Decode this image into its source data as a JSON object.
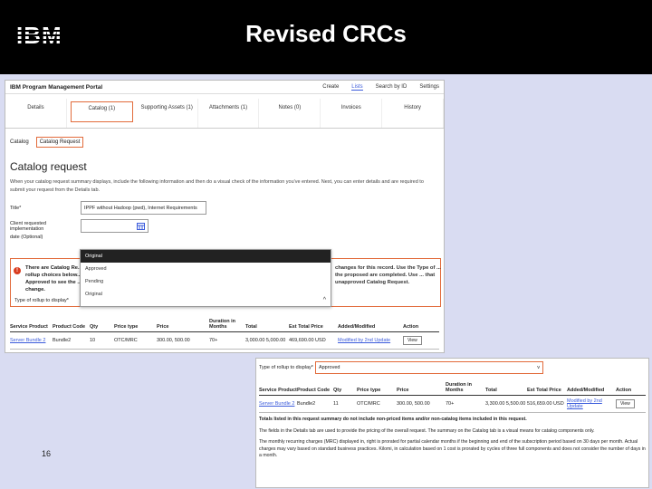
{
  "slide": {
    "logo_text": "IBM",
    "title": "Revised CRCs",
    "page_number": "16"
  },
  "portal": {
    "brand": "IBM Program Management Portal",
    "menus": [
      "Create",
      "Lists",
      "Search by ID",
      "Settings"
    ],
    "tabs": [
      "Details",
      "Catalog (1)",
      "Supporting Assets (1)",
      "Attachments (1)",
      "Notes (0)",
      "Invoices",
      "History"
    ],
    "crumbs": [
      "Catalog",
      "Catalog Request"
    ],
    "heading": "Catalog request",
    "description": "When your catalog request summary displays, include the following information and then do a visual check of the information you've entered. Next, you can enter details and are required to submit your request from the Details tab.",
    "title_label": "Title*",
    "title_value": "IPPF without Hadoop (pwd), Internet Requirements",
    "date_label": "Client requested implementation",
    "date_label2": "date (Optional)",
    "warning_left": "There are Catalog Re... rollup choices below... Approved to see the ... change.",
    "warning_right": "changes for this record. Use the Type of ... the proposed are completed. Use ... that unapproved Catalog Request.",
    "type_label": "Type of rollup to display*",
    "dropdown_options": [
      "Original",
      "Approved",
      "Pending",
      "Original"
    ],
    "headers": [
      "Service Product",
      "Product Code",
      "Qty",
      "Price type",
      "Price",
      "Duration in Months",
      "Total",
      "Est Total Price",
      "Added/Modified",
      "Action"
    ],
    "row": {
      "service_product": "Server Bundle 2",
      "product_code": "Bundle2",
      "qty": "10",
      "price_type": "OTC/MRC",
      "price": "300.00, 500.00",
      "duration": "70+",
      "total": "3,000.00 5,000.00",
      "est_total": "469,690.00 USD",
      "modified": "Modified by 2nd Update",
      "action": "View"
    }
  },
  "portal2": {
    "type_label": "Type of rollup to display*",
    "selected": "Approved",
    "headers": [
      "Service Product",
      "Product Code",
      "Qty",
      "Price type",
      "Price",
      "Duration in Months",
      "Total",
      "Est Total Price",
      "Added/Modified",
      "Action"
    ],
    "row": {
      "service_product": "Server Bundle 2",
      "product_code": "Bundle2",
      "qty": "11",
      "price_type": "OTC/MRC",
      "price": "300.00, 500.00",
      "duration": "70+",
      "total": "3,300.00 5,500.00",
      "est_total": "516,659.00 USD",
      "modified": "Modified by 2nd Update",
      "action": "View"
    },
    "note_bold": "Totals listed in this request summary do not include non-priced items and/or non-catalog items included in this request.",
    "note_normal": "The fields in the Details tab are used to provide the pricing of the overall request. The summary on the Catalog tab is a visual means for catalog components only.",
    "note_small": "The monthly recurring charges (MRC) displayed in, right is prorated for partial calendar months if the beginning and end of the subscription period based on 30 days per month. Actual charges may vary based on standard business practices. Kilomi, in calculation based on 1 cost is prorated by cycles of three full components and does not consider the number of days in a month."
  },
  "colors": {
    "accent": "#e26b3b",
    "link": "#3b5bdb",
    "background": "#d9dcf2"
  }
}
